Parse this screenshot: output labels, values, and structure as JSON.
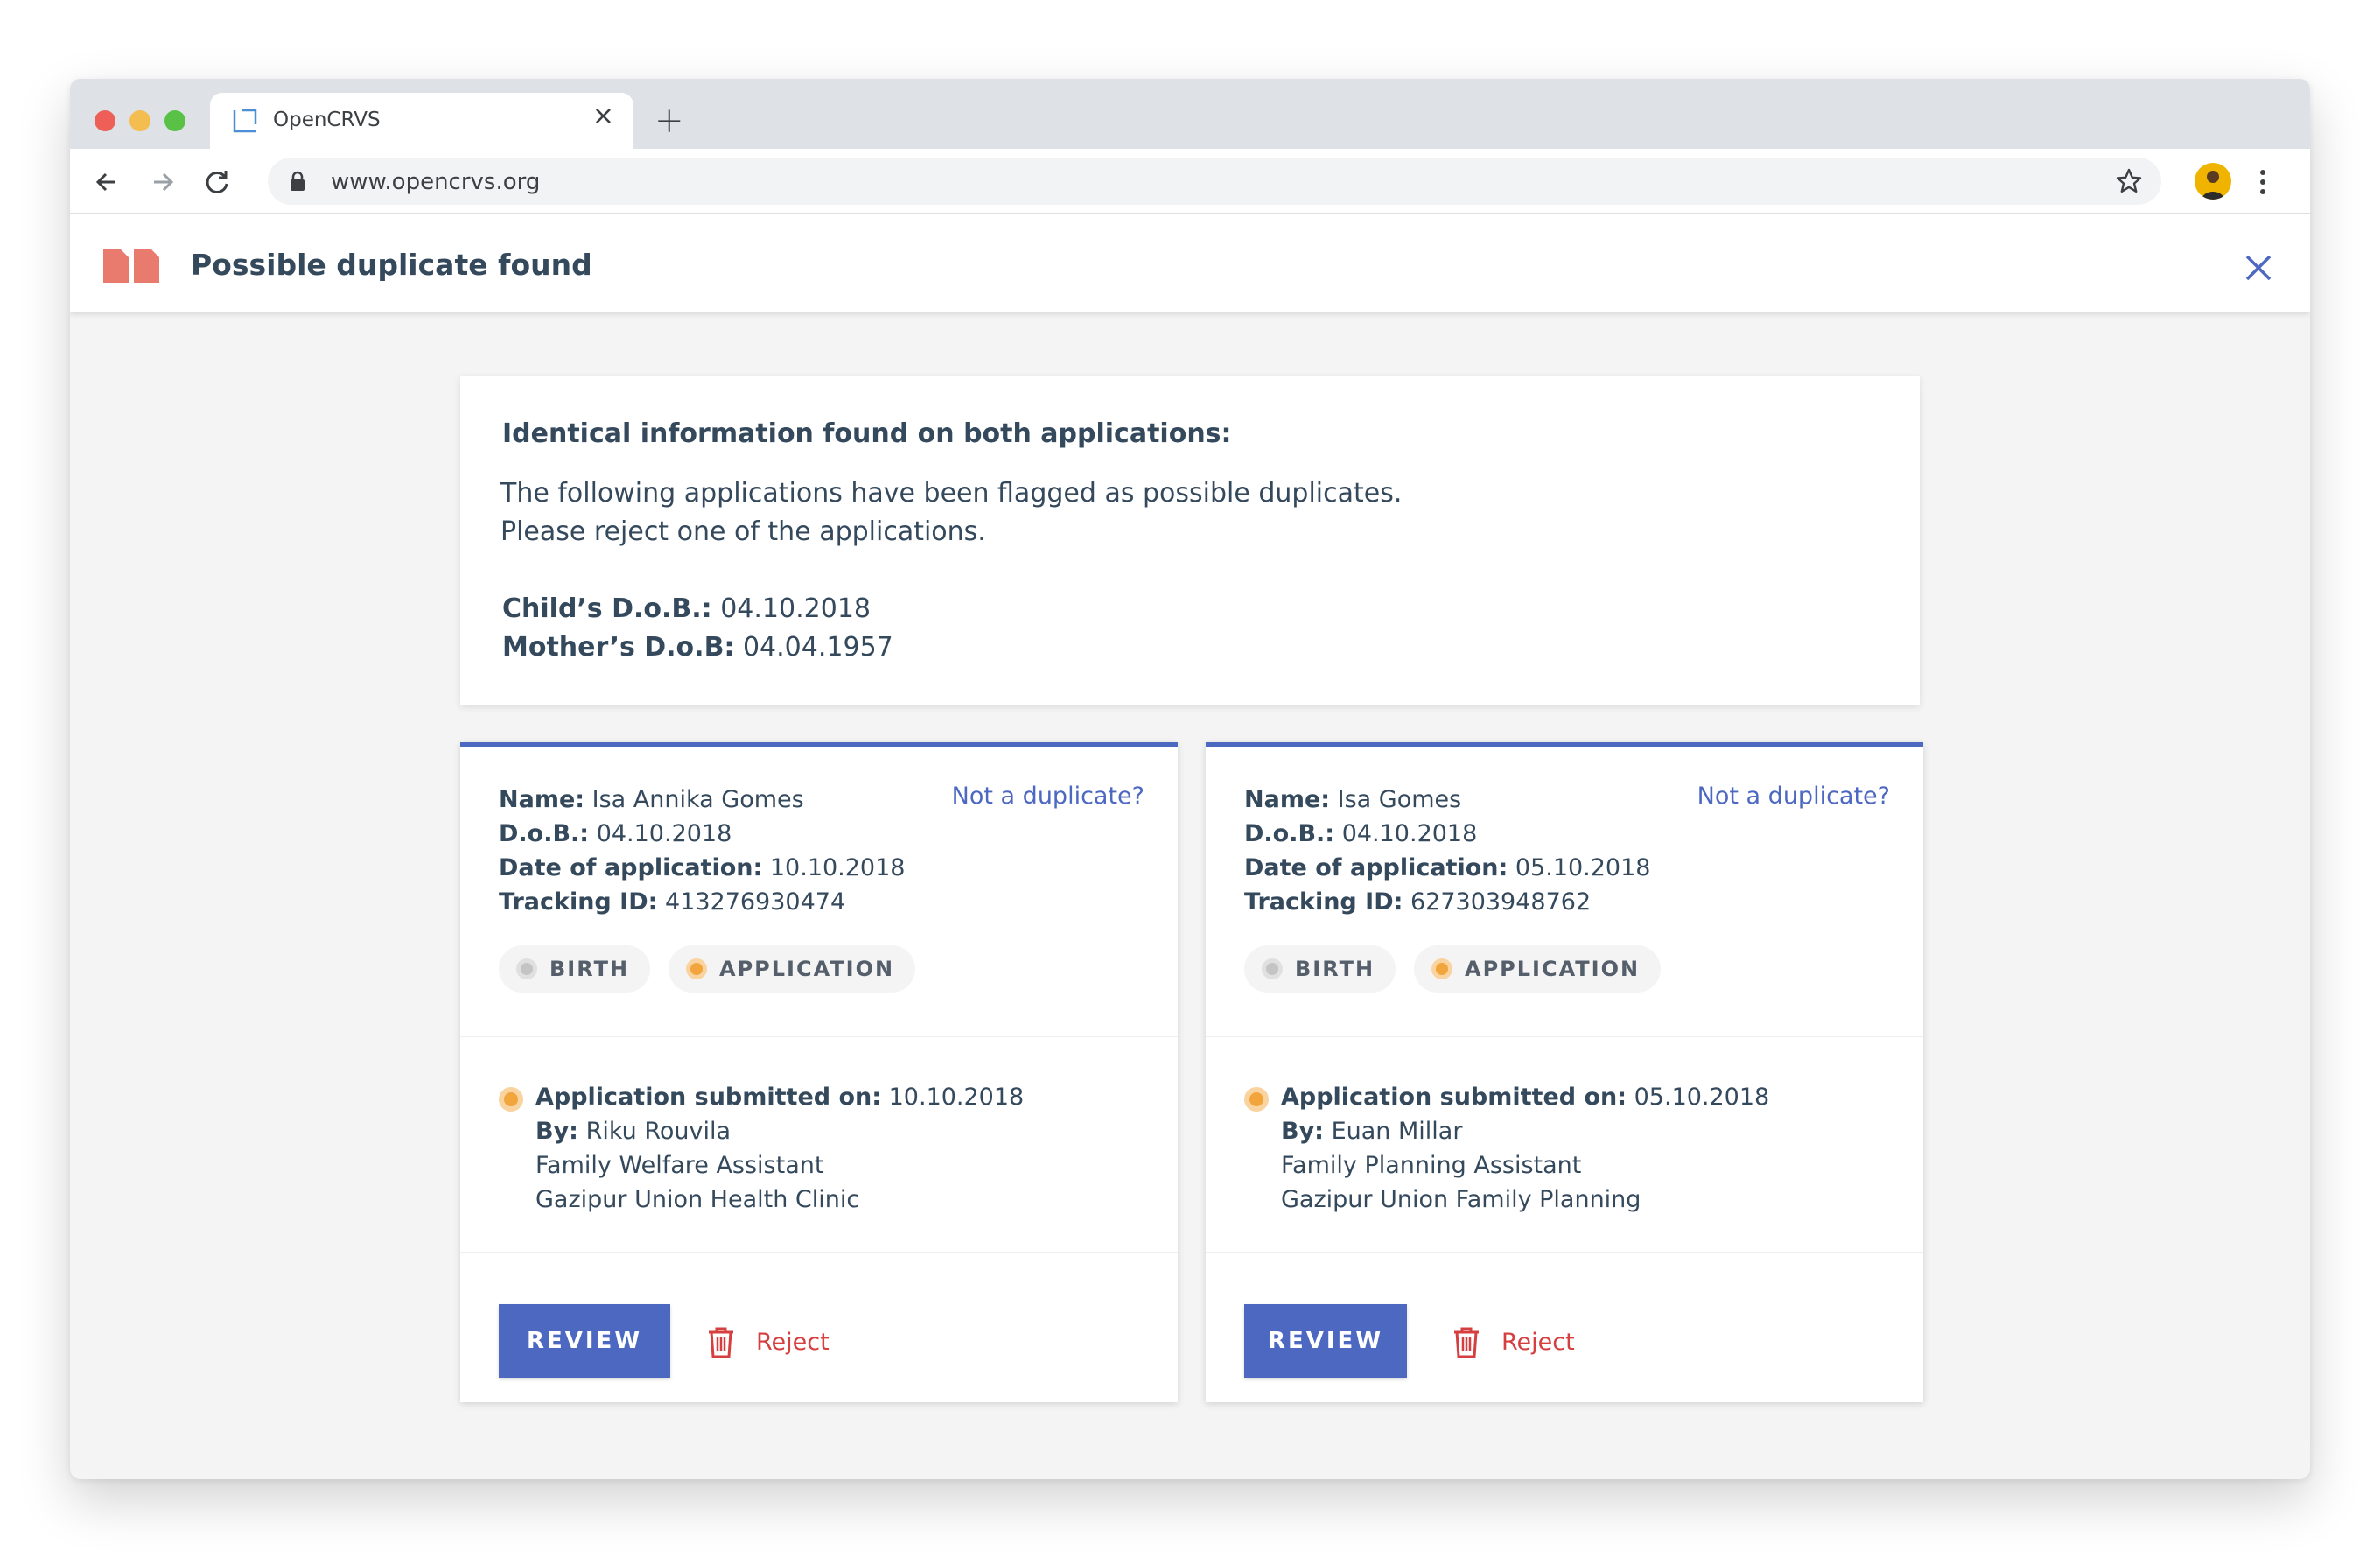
{
  "browser": {
    "tab_title": "OpenCRVS",
    "tab_close": "×",
    "new_tab": "+",
    "url": "www.opencrvs.org"
  },
  "header": {
    "title": "Possible duplicate found"
  },
  "summary": {
    "heading": "Identical information found on both applications:",
    "line1": "The following applications have been flagged as possible duplicates.",
    "line2": "Please reject one of the applications.",
    "child_dob_label": "Child’s D.o.B.:",
    "child_dob_value": " 04.10.2018",
    "mother_dob_label": "Mother’s D.o.B:",
    "mother_dob_value": " 04.04.1957"
  },
  "cards": [
    {
      "name_label": "Name:",
      "name": " Isa Annika Gomes",
      "dob_label": "D.o.B.:",
      "dob": " 04.10.2018",
      "date_label": "Date of application:",
      "date": " 10.10.2018",
      "tracking_label": "Tracking ID:",
      "tracking": " 413276930474",
      "not_duplicate": "Not a duplicate?",
      "tag_birth": "BIRTH",
      "tag_application": "APPLICATION",
      "submitted_label": "Application submitted on:",
      "submitted": " 10.10.2018",
      "by_label": "By:",
      "by": " Riku Rouvila",
      "role": "Family Welfare Assistant",
      "office": "Gazipur Union Health Clinic",
      "review": "REVIEW",
      "reject": "Reject"
    },
    {
      "name_label": "Name:",
      "name": " Isa Gomes",
      "dob_label": "D.o.B.:",
      "dob": " 04.10.2018",
      "date_label": "Date of application:",
      "date": " 05.10.2018",
      "tracking_label": "Tracking ID:",
      "tracking": " 627303948762",
      "not_duplicate": "Not a duplicate?",
      "tag_birth": "BIRTH",
      "tag_application": "APPLICATION",
      "submitted_label": "Application submitted on:",
      "submitted": " 05.10.2018",
      "by_label": "By:",
      "by": " Euan Millar",
      "role": "Family Planning Assistant",
      "office": "Gazipur Union Family Planning",
      "review": "REVIEW",
      "reject": "Reject"
    }
  ],
  "colors": {
    "primary": "#4c68c1",
    "danger": "#d53f3f",
    "orange_status": "#f2a53c",
    "text": "#35495d"
  },
  "icons": {
    "duplicate": "duplicate-icon",
    "close": "close-icon",
    "trash": "trash-icon"
  }
}
